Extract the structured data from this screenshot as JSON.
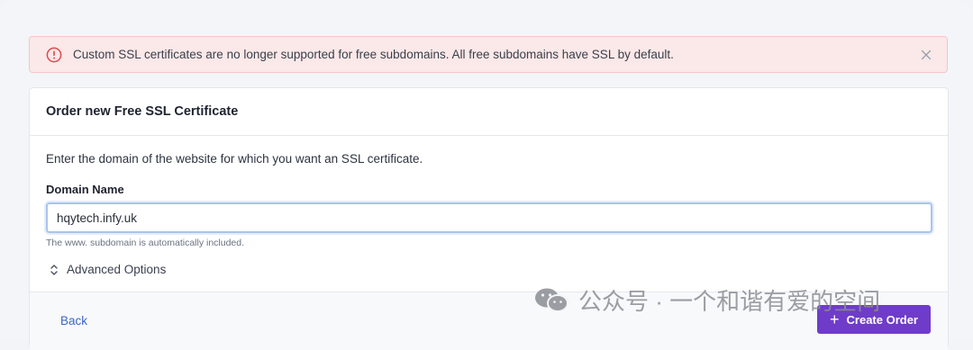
{
  "alert": {
    "message": "Custom SSL certificates are no longer supported for free subdomains. All free subdomains have SSL by default.",
    "icon": "alert-circle-icon",
    "close_icon": "close-icon",
    "color": "#e0474c"
  },
  "card": {
    "title": "Order new Free SSL Certificate",
    "description": "Enter the domain of the website for which you want an SSL certificate.",
    "domain_label": "Domain Name",
    "domain_value": "hqytech.infy.uk",
    "hint": "The www. subdomain is automatically included.",
    "advanced_label": "Advanced Options"
  },
  "footer": {
    "back_label": "Back",
    "create_label": "Create Order",
    "create_icon": "plus-icon",
    "accent": "#6f3cc9"
  },
  "watermark": {
    "text": "公众号 · 一个和谐有爱的空间",
    "icon": "wechat-icon"
  }
}
